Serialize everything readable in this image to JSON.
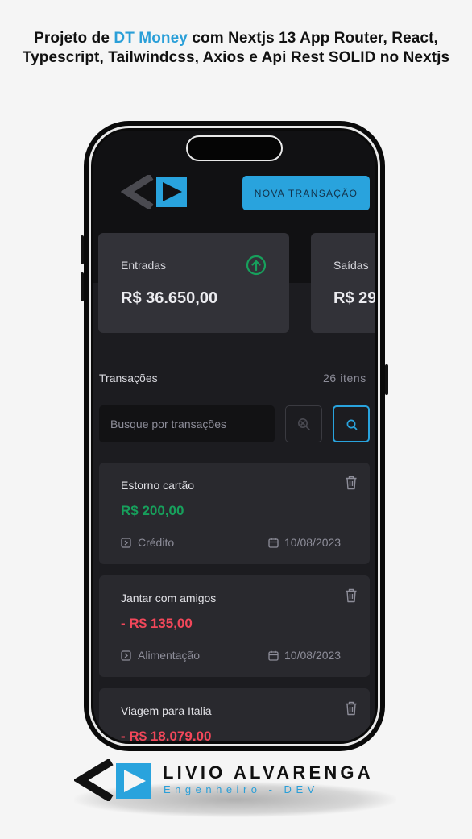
{
  "headline": {
    "before": "Projeto de ",
    "highlight": "DT Money",
    "after": " com Nextjs 13 App Router, React, Typescript, Tailwindcss, Axios e Api Rest SOLID no Nextjs"
  },
  "app": {
    "new_transaction_label": "NOVA TRANSAÇÃO",
    "summary": {
      "income_label": "Entradas",
      "income_value": "R$ 36.650,00",
      "outcome_label": "Saídas",
      "outcome_value": "R$ 29"
    },
    "transactions_title": "Transações",
    "transactions_count": "26 itens",
    "search": {
      "placeholder": "Busque por transações"
    },
    "transactions": [
      {
        "description": "Estorno cartão",
        "amount": "R$ 200,00",
        "type": "income",
        "category": "Crédito",
        "date": "10/08/2023"
      },
      {
        "description": "Jantar com amigos",
        "amount": "- R$ 135,00",
        "type": "outcome",
        "category": "Alimentação",
        "date": "10/08/2023"
      },
      {
        "description": "Viagem para Italia",
        "amount": "- R$ 18.079,00",
        "type": "outcome",
        "category": "",
        "date": ""
      }
    ]
  },
  "brand": {
    "name": "LIVIO ALVARENGA",
    "subtitle": "Engenheiro - DEV"
  },
  "colors": {
    "accent": "#29a3dd",
    "income": "#17a05c",
    "outcome": "#f2475a",
    "card": "#323238"
  },
  "icons": {
    "income": "arrow-circle-up-icon",
    "clear": "magnifier-x-icon",
    "search": "search-icon",
    "category": "tag-square-icon",
    "date": "calendar-icon",
    "delete": "trash-icon"
  }
}
